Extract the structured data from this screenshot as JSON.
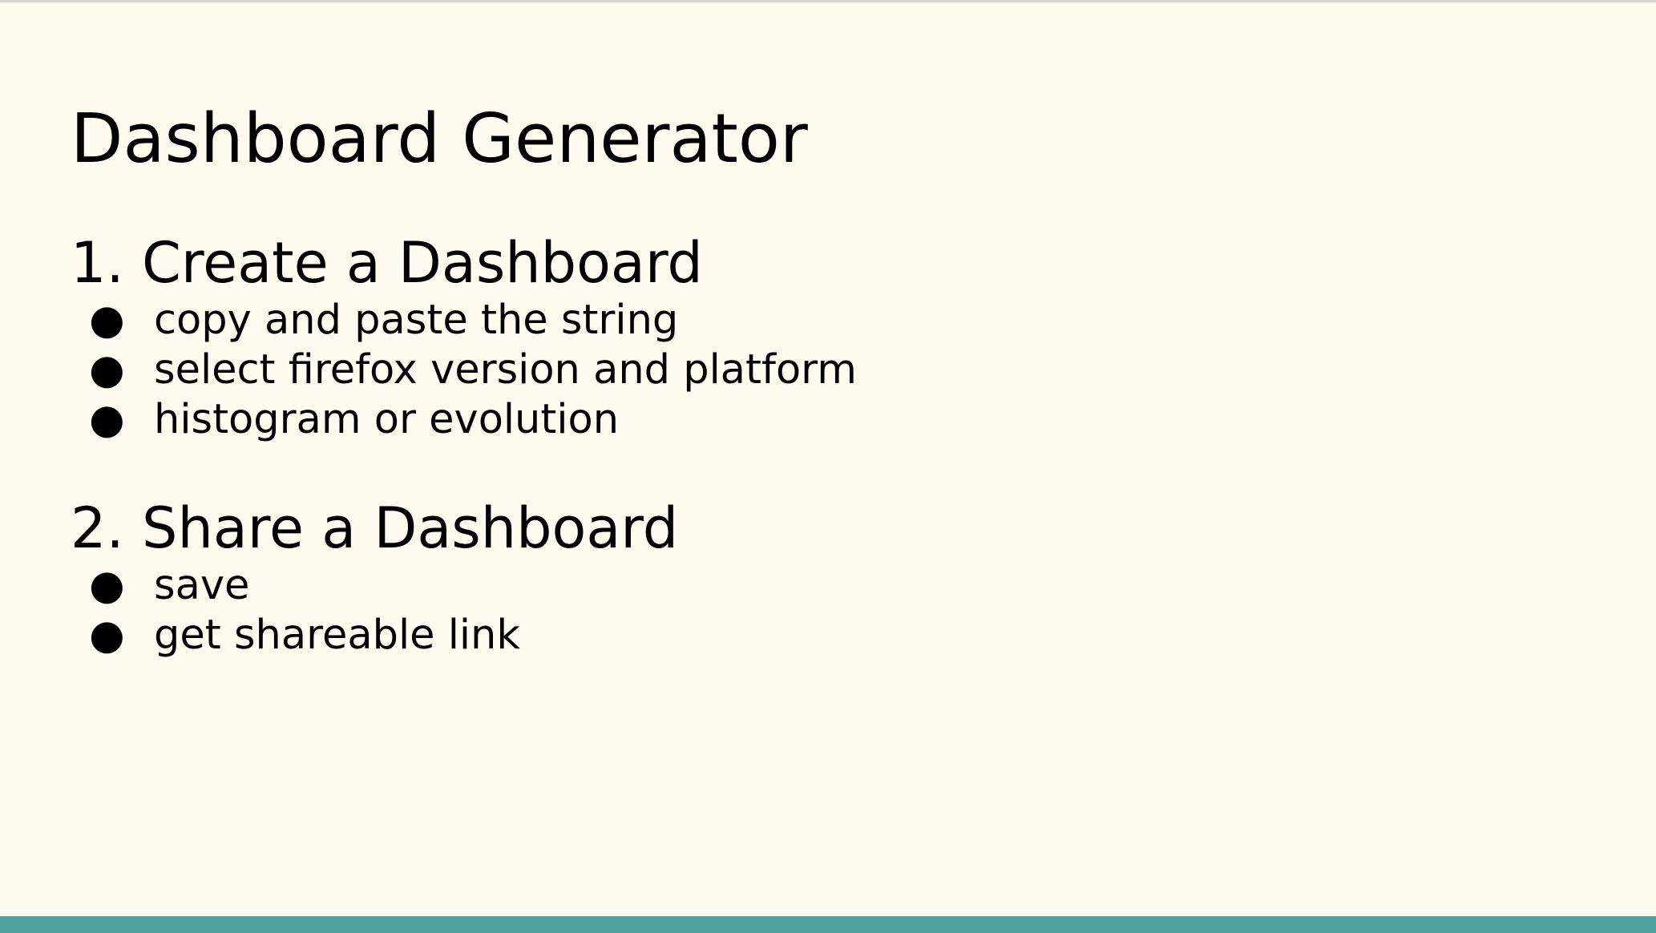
{
  "slide": {
    "title": "Dashboard Generator",
    "sections": [
      {
        "heading": "1. Create a Dashboard",
        "items": [
          "copy and paste the string",
          "select firefox version and platform",
          "histogram or evolution"
        ]
      },
      {
        "heading": "2. Share a Dashboard",
        "items": [
          "save",
          "get shareable link"
        ]
      }
    ],
    "bullet_glyph": "●"
  },
  "colors": {
    "background": "#fefcf0",
    "text": "#000000",
    "accent_bar": "#4fa39a"
  }
}
